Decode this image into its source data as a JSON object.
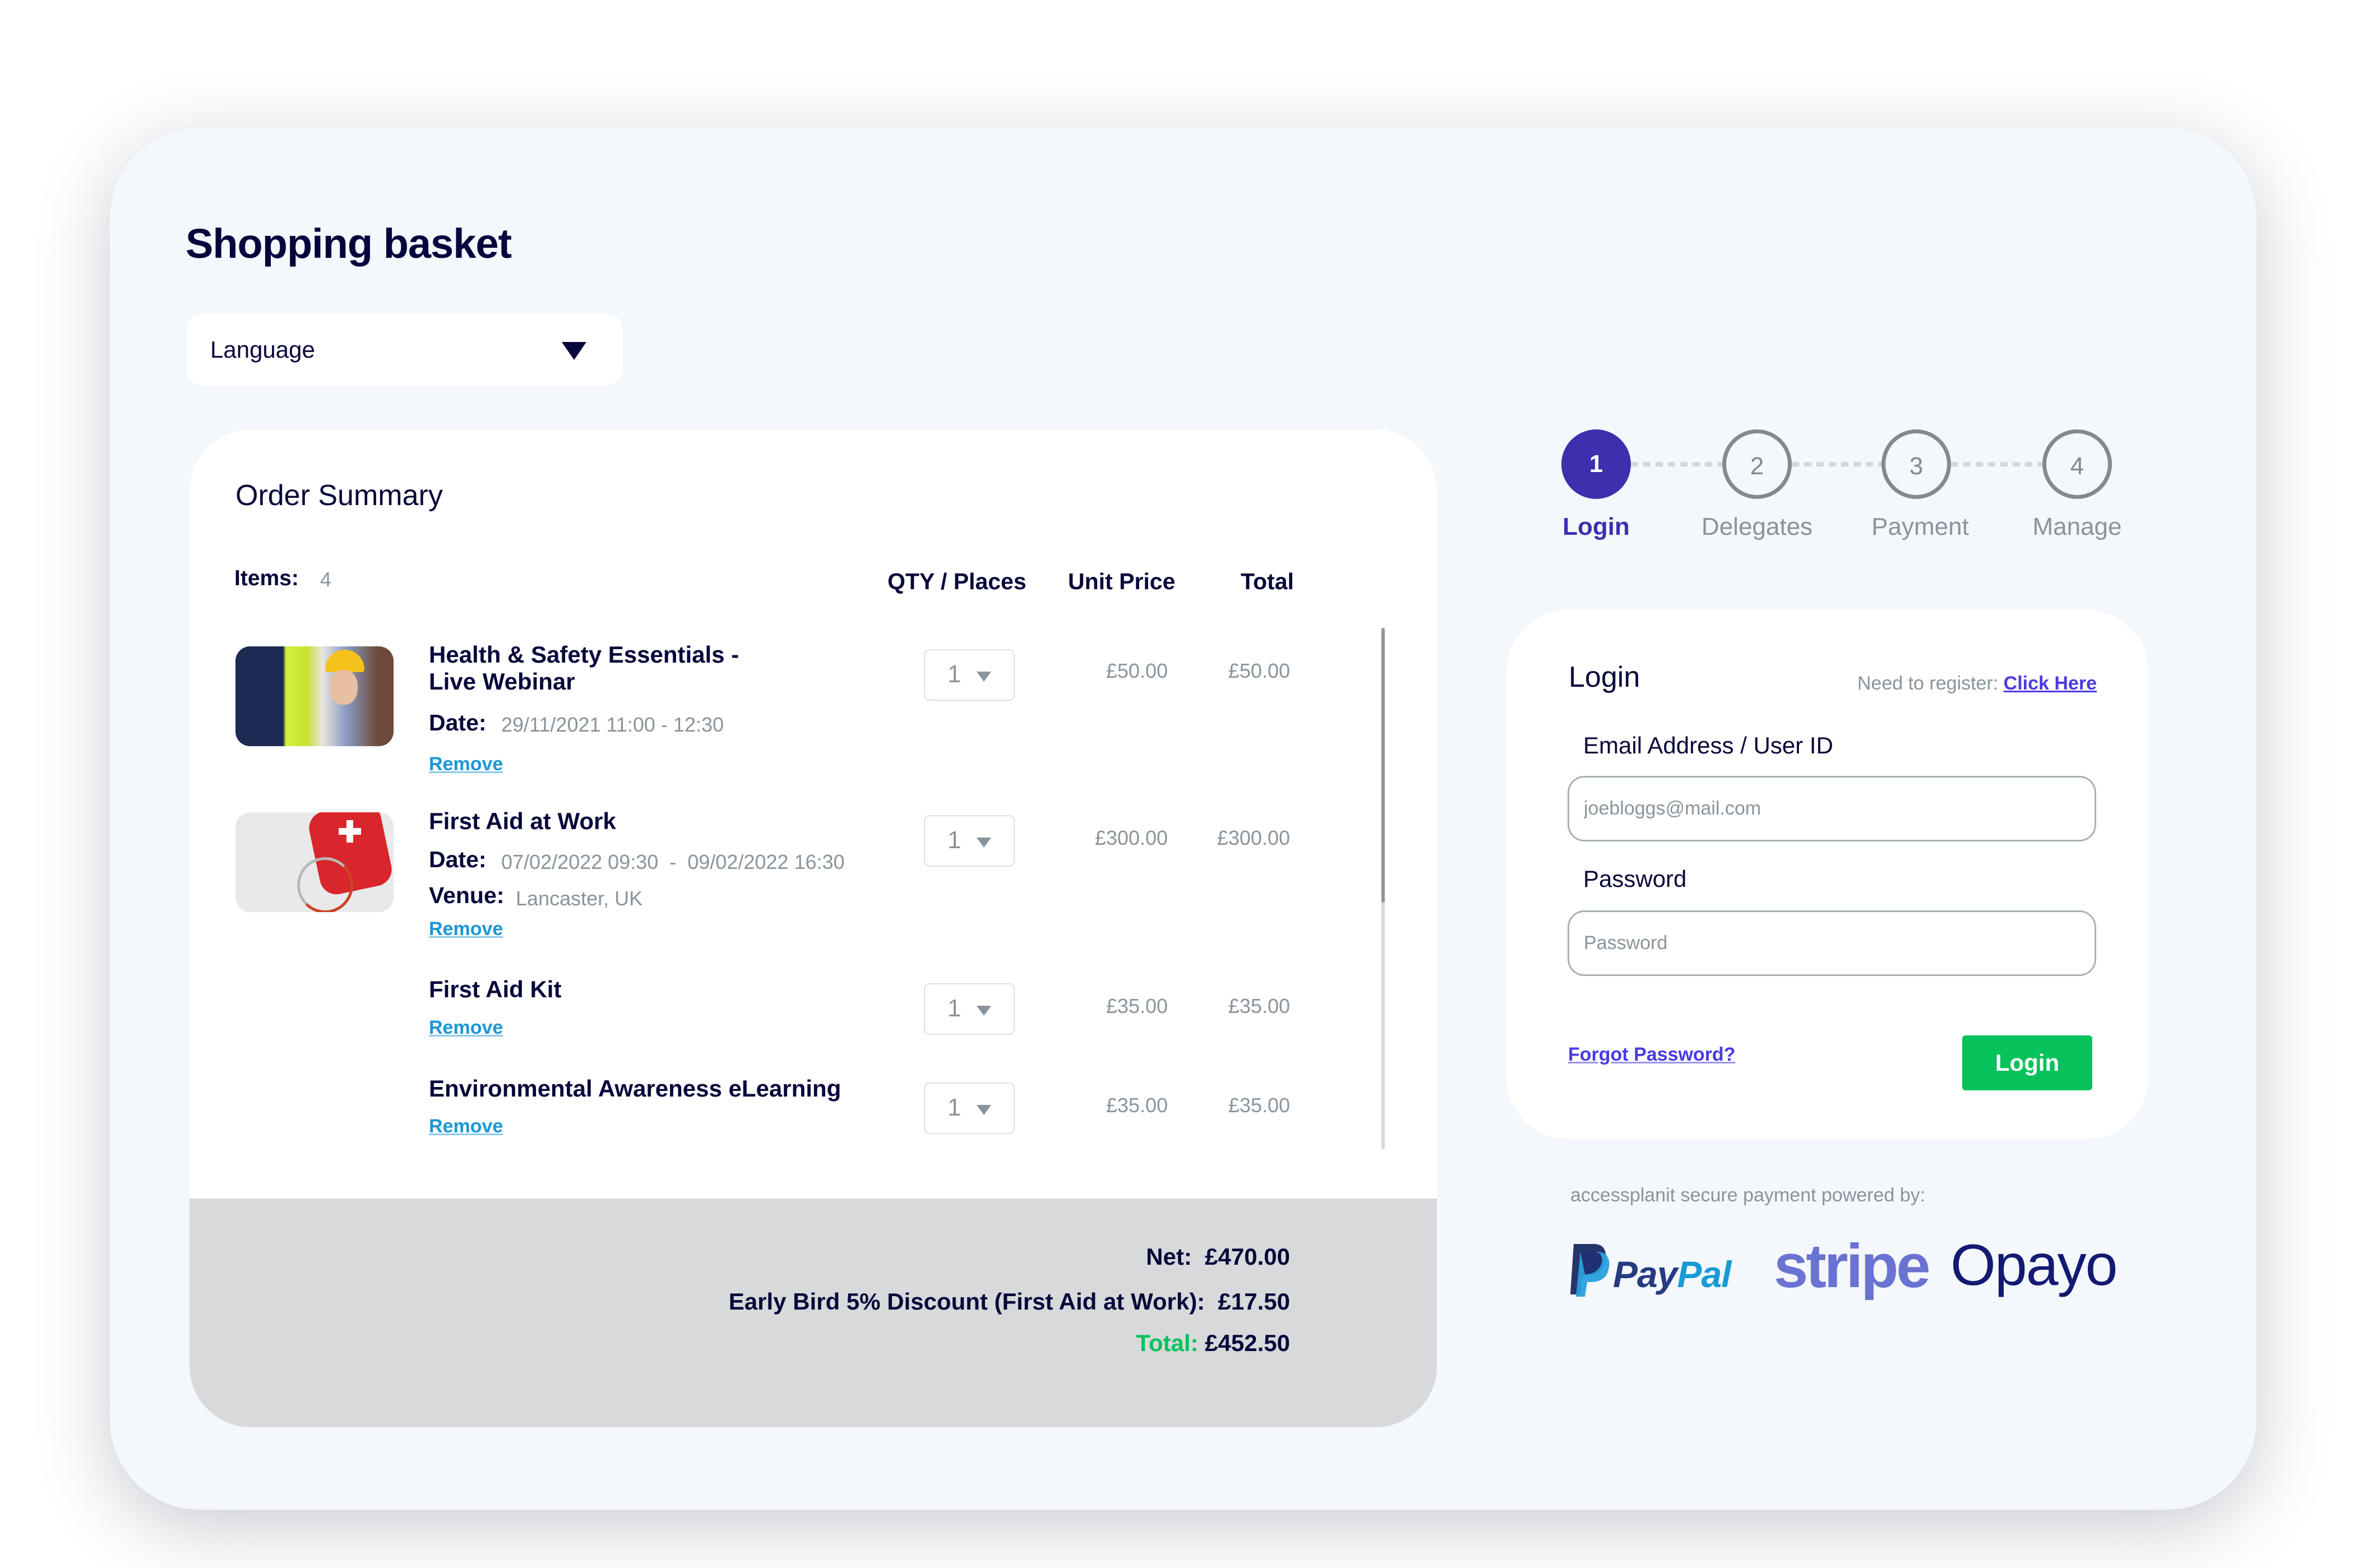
{
  "page": {
    "title": "Shopping basket"
  },
  "language": {
    "label": "Language"
  },
  "order": {
    "heading": "Order Summary",
    "items_label": "Items:",
    "items_count": "4",
    "columns": {
      "qty": "QTY / Places",
      "unit": "Unit Price",
      "total": "Total"
    },
    "rows": [
      {
        "name_line1": "Health & Safety Essentials -",
        "name_line2": "Live Webinar",
        "date_label": "Date:",
        "date": "29/11/2021 11:00 - 12:30",
        "remove": "Remove",
        "qty": "1",
        "unit_price": "£50.00",
        "total": "£50.00",
        "image": "worker-hardhat-photo"
      },
      {
        "name_line1": "First Aid at Work",
        "date_label": "Date:",
        "date": "07/02/2022 09:30  -  09/02/2022 16:30",
        "venue_label": "Venue:",
        "venue": "Lancaster, UK",
        "remove": "Remove",
        "qty": "1",
        "unit_price": "£300.00",
        "total": "£300.00",
        "image": "first-aid-kit-photo"
      },
      {
        "name_line1": "First Aid Kit",
        "remove": "Remove",
        "qty": "1",
        "unit_price": "£35.00",
        "total": "£35.00"
      },
      {
        "name_line1": "Environmental Awareness eLearning",
        "remove": "Remove",
        "qty": "1",
        "unit_price": "£35.00",
        "total": "£35.00"
      }
    ],
    "summary": {
      "net_label": "Net:",
      "net": "£470.00",
      "discount_label": "Early Bird 5% Discount (First Aid at Work):",
      "discount": "£17.50",
      "total_label": "Total:",
      "total": "£452.50"
    }
  },
  "stepper": {
    "active_index": 0,
    "steps": [
      {
        "number": "1",
        "label": "Login"
      },
      {
        "number": "2",
        "label": "Delegates"
      },
      {
        "number": "3",
        "label": "Payment"
      },
      {
        "number": "4",
        "label": "Manage"
      }
    ]
  },
  "login": {
    "heading": "Login",
    "register_prompt": "Need to register:",
    "register_link": "Click Here",
    "email_label": "Email Address / User ID",
    "email_placeholder": "joebloggs@mail.com",
    "email_value": "",
    "password_label": "Password",
    "password_placeholder": "Password",
    "password_value": "",
    "forgot": "Forgot Password?",
    "submit": "Login"
  },
  "payment": {
    "powered_by": "accessplanit secure payment powered by:",
    "providers": [
      "PayPal",
      "stripe",
      "Opayo"
    ],
    "paypal_pay": "Pay",
    "paypal_pal": "Pal"
  },
  "colors": {
    "primary": "#3d2fae",
    "accent_link": "#4b3ae0",
    "remove_link": "#1b97d6",
    "success": "#06c25a",
    "text_dark": "#07073a",
    "muted": "#8a949c"
  }
}
